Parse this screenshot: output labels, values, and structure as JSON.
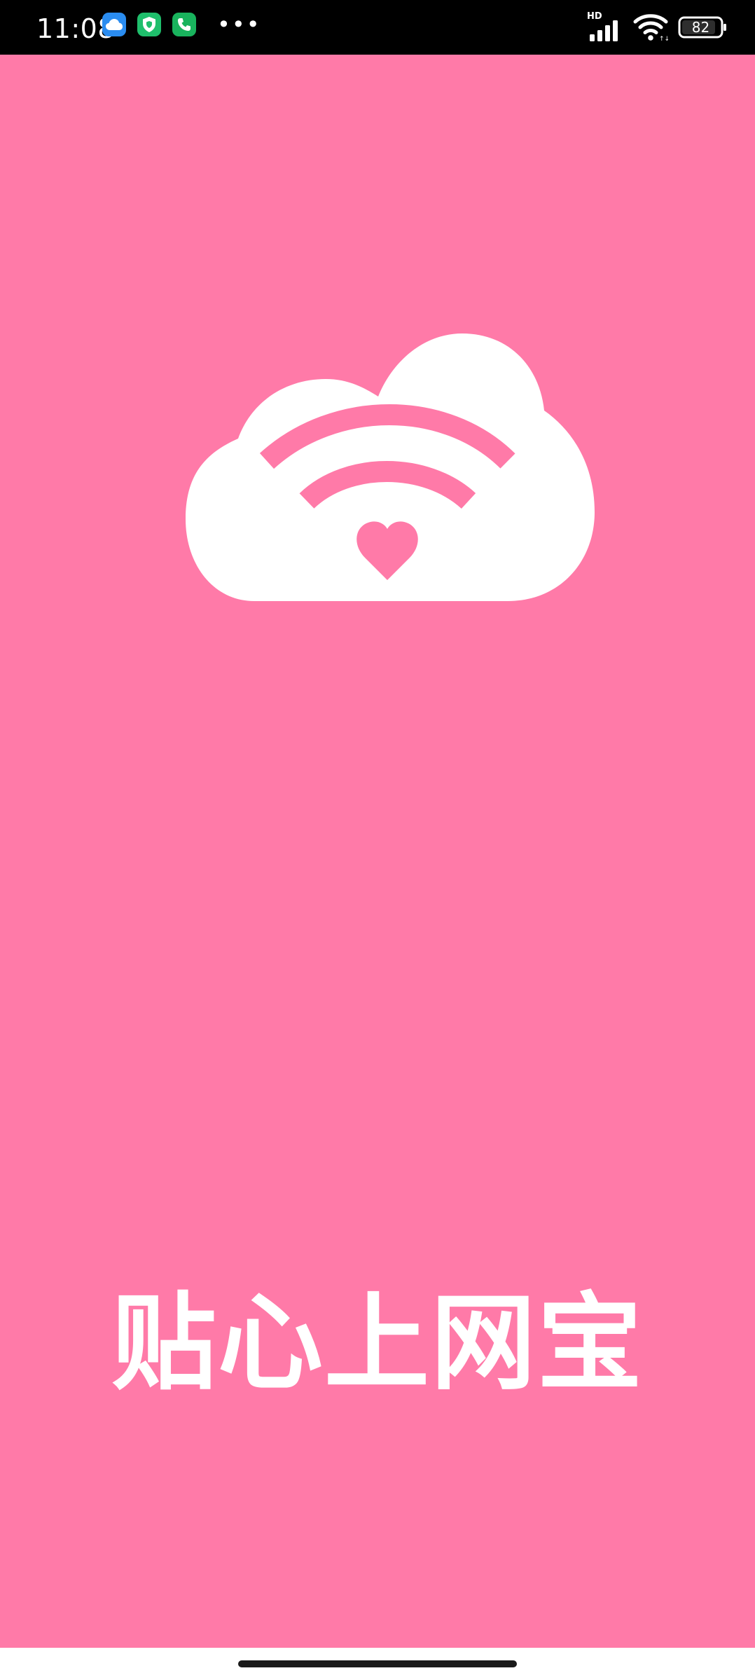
{
  "status_bar": {
    "time": "11:08",
    "more_indicator": "•••",
    "network_label": "HD",
    "battery_level": "82",
    "notification_icons": [
      "cloud-app-icon",
      "security-shield-icon",
      "phone-call-icon"
    ]
  },
  "splash": {
    "title": "贴心上网宝",
    "logo_icon": "cloud-wifi-heart-icon"
  },
  "colors": {
    "background": "#ff7aa8",
    "status_bar": "#000000",
    "logo": "#ffffff",
    "title_text": "#ffffff"
  }
}
